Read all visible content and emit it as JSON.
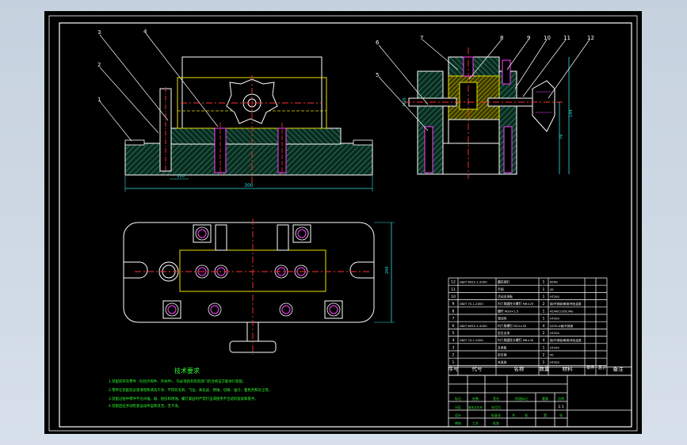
{
  "viewer": {
    "background_color": "#cdd8e4",
    "canvas_color": "#000000"
  },
  "front_view": {
    "callouts": [
      "1",
      "2",
      "3",
      "4"
    ],
    "width_dim": "300",
    "height_dim": "110"
  },
  "side_view": {
    "callouts": [
      "5",
      "6",
      "7",
      "8",
      "9",
      "10",
      "11",
      "12"
    ],
    "height_dim": "144",
    "height_dim2": "79"
  },
  "top_view": {
    "depth_dim": "200"
  },
  "technical_requirements": {
    "title": "技术要求",
    "lines": [
      "1.装配前所有零件（包括外购件、外协件），均必须具有检验部门的合格证方能进行装配。",
      "2.零件在装配前必须清理和清洗干净，不得有毛刺、飞边、氧化皮、锈蚀、切屑、油污、着色剂和灰尘等。",
      "3.装配过程中零件不允许磕、碰、划伤和锈蚀。螺钉紧固时严禁打击或使用不合适的旋具和扳手。",
      "4.装配后应手动检查运动件运转灵活，无卡滞。"
    ]
  },
  "bom": {
    "header": {
      "no": "序号",
      "code": "代号",
      "name": "名称",
      "qty": "数量",
      "material": "材料",
      "unit_mass": "单件",
      "total_mass": "总计",
      "note": "备注"
    },
    "rows": [
      {
        "no": "12",
        "code": "GB/T 6052.1-2000",
        "name": "圆柱销钉",
        "qty": "1",
        "material": "65Mn"
      },
      {
        "no": "11",
        "code": "",
        "name": "手柄",
        "qty": "1",
        "material": "45"
      },
      {
        "no": "10",
        "code": "",
        "name": "活动支承板",
        "qty": "1",
        "material": "HT200"
      },
      {
        "no": "9",
        "code": "GB/T 70.1-2000",
        "name": "内六角圆柱头螺钉 M6×25",
        "qty": "2",
        "material": "钢/不锈钢/黄铜/有色金属"
      },
      {
        "no": "8",
        "code": "",
        "name": "螺杆 M20×1.5",
        "qty": "1",
        "material": "45/40Cr/35CrMo"
      },
      {
        "no": "7",
        "code": "",
        "name": "滑动块",
        "qty": "1",
        "material": "HT200"
      },
      {
        "no": "6",
        "code": "GB/T 6052.1-2000",
        "name": "内六角螺钉 M12×35",
        "qty": "4",
        "material": "Q235-A钢/不锈钢"
      },
      {
        "no": "5",
        "code": "",
        "name": "定位支承",
        "qty": "2",
        "material": "HT200"
      },
      {
        "no": "4",
        "code": "GB/T 70.1-2000",
        "name": "内六角圆柱头螺钉 M8×30",
        "qty": "4",
        "material": "钢/不锈钢/黄铜/有色金属"
      },
      {
        "no": "3",
        "code": "",
        "name": "支承板",
        "qty": "1",
        "material": "HT200"
      },
      {
        "no": "2",
        "code": "",
        "name": "定位销",
        "qty": "2",
        "material": "45"
      },
      {
        "no": "1",
        "code": "",
        "name": "夹具体",
        "qty": "1",
        "material": "HT200"
      }
    ]
  },
  "title_block": {
    "labels": [
      "标记",
      "处数",
      "分区",
      "更改文件号",
      "签名",
      "年月日",
      "设计",
      "标准化",
      "阶段标记",
      "重量",
      "比例",
      "审核",
      "工艺",
      "批准",
      "共",
      "张",
      "第",
      "张"
    ],
    "scale": "1:1"
  },
  "colors": {
    "frame": "#ffffff",
    "part": "#ffffff",
    "hatch": "#1e7a5c",
    "yellow": "#e8e000",
    "red": "#ff3030",
    "magenta": "#ff40ff",
    "green_text": "#30ff30",
    "cyan": "#30e0e0"
  }
}
